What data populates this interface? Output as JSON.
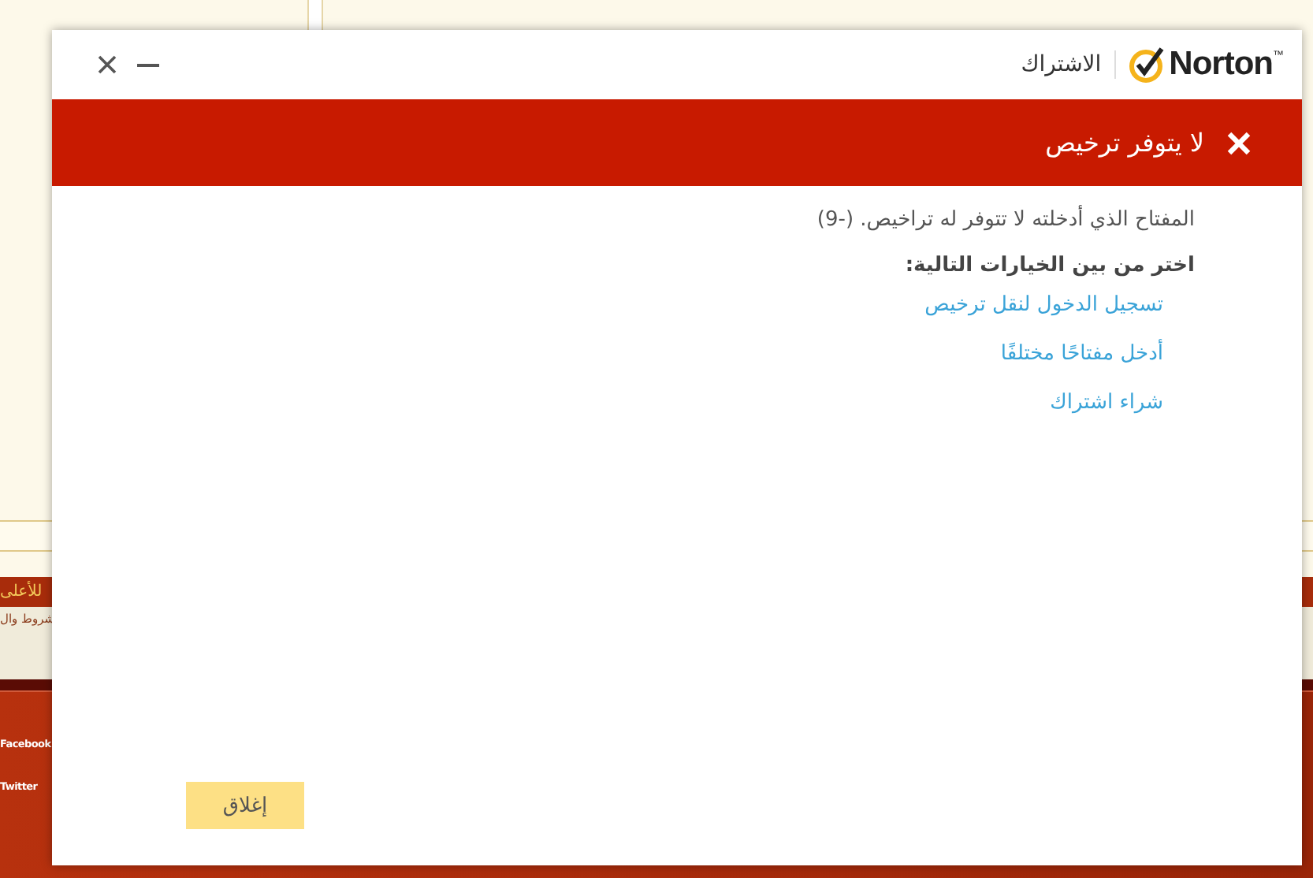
{
  "background_page": {
    "nav_link": "للأعلى",
    "footer_link": "شروط وال",
    "social_links": [
      "Facebook",
      "Twitter"
    ]
  },
  "window": {
    "brand": "Norton",
    "brand_mark": "™",
    "section": "الاشتراك"
  },
  "error_banner": {
    "title": "لا يتوفر ترخيص"
  },
  "message": "المفتاح الذي أدخلته لا تتوفر له تراخيص. (-9)",
  "prompt": "اختر من بين الخيارات التالية:",
  "options": [
    {
      "label": "تسجيل الدخول لنقل ترخيص"
    },
    {
      "label": "أدخل مفتاحًا مختلفًا"
    },
    {
      "label": "شراء اشتراك"
    }
  ],
  "buttons": [
    {
      "label": "إغلاق"
    }
  ]
}
